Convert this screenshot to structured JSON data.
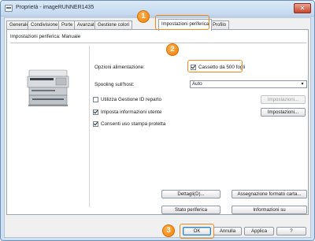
{
  "window": {
    "title": "Proprietà - imageRUNNER1435",
    "close_glyph": "✕"
  },
  "tabs": [
    {
      "label": "Generale"
    },
    {
      "label": "Condivisione"
    },
    {
      "label": "Porte"
    },
    {
      "label": "Avanzate"
    },
    {
      "label": "Gestione colori"
    },
    {
      "label": "Impostazioni periferica"
    },
    {
      "label": "Profilo"
    }
  ],
  "panel": {
    "title": "Impostazioni periferica: Manuale",
    "paper_options_label": "Opzioni alimentazione:",
    "paper_drawer_label": "Cassetto da 500 fogli",
    "spooling_label": "Spooling sull'host:",
    "spooling_value": "Auto",
    "dept_id_label": "Utilizza Gestione ID reparto",
    "user_info_label": "Imposta informazioni utente",
    "secure_print_label": "Consenti uso stampa protetta",
    "dept_settings_button": "Impostazioni...",
    "user_settings_button": "Impostazioni..."
  },
  "panel_buttons": {
    "details": "Dettagli(D)...",
    "paper_format": "Assegnazione formato carta...",
    "device_status": "Stato periferica",
    "about": "Informazioni su"
  },
  "footer": {
    "ok": "OK",
    "cancel": "Annulla",
    "apply": "Applica",
    "help": "?"
  },
  "steps": [
    "1",
    "2",
    "3"
  ],
  "colors": {
    "highlight": "#f08a1c",
    "step_badge": "#ee7d08",
    "titlebar": "#c3d7ee"
  }
}
